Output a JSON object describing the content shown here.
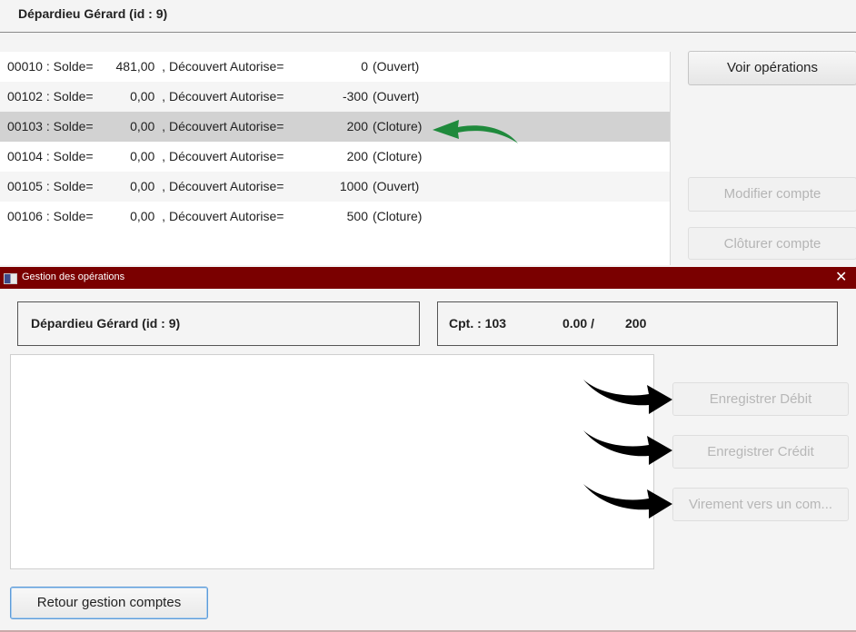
{
  "main": {
    "client_header": "Dépardieu  Gérard  (id : 9)",
    "accounts": [
      {
        "num": "00010 : Solde=",
        "solde": "481,00",
        "sep": ",",
        "decouvert_label": "Découvert Autorise=",
        "decouvert": "0",
        "state": "(Ouvert)"
      },
      {
        "num": "00102 : Solde=",
        "solde": "0,00",
        "sep": ",",
        "decouvert_label": "Découvert Autorise=",
        "decouvert": "-300",
        "state": "(Ouvert)"
      },
      {
        "num": "00103 : Solde=",
        "solde": "0,00",
        "sep": ",",
        "decouvert_label": "Découvert Autorise=",
        "decouvert": "200",
        "state": "(Cloture)"
      },
      {
        "num": "00104 : Solde=",
        "solde": "0,00",
        "sep": ",",
        "decouvert_label": "Découvert Autorise=",
        "decouvert": "200",
        "state": "(Cloture)"
      },
      {
        "num": "00105 : Solde=",
        "solde": "0,00",
        "sep": ",",
        "decouvert_label": "Découvert Autorise=",
        "decouvert": "1000",
        "state": "(Ouvert)"
      },
      {
        "num": "00106 : Solde=",
        "solde": "0,00",
        "sep": ",",
        "decouvert_label": "Découvert Autorise=",
        "decouvert": "500",
        "state": "(Cloture)"
      }
    ],
    "selected_index": 2,
    "buttons": {
      "voir_operations": "Voir opérations",
      "modifier_compte": "Modifier compte",
      "cloturer_compte": "Clôturer compte"
    }
  },
  "dialog": {
    "title": "Gestion des opérations",
    "close_glyph": "✕",
    "client_info": "Dépardieu  Gérard  (id : 9)",
    "account_label": "Cpt. : 103",
    "account_solde": "0.00  /",
    "account_decouvert": "200",
    "buttons": {
      "debit": "Enregistrer Débit",
      "credit": "Enregistrer Crédit",
      "virement": "Virement vers un com...",
      "retour": "Retour gestion comptes"
    }
  },
  "colors": {
    "titlebar": "#7a0000",
    "selection": "#d2d2d2",
    "green_arrow": "#1f8a3c",
    "black_arrow": "#000000"
  },
  "icons": {
    "app": "app-window-icon",
    "close": "close-icon",
    "annotation_arrows": [
      "green-curved-arrow",
      "black-curved-arrow"
    ]
  }
}
